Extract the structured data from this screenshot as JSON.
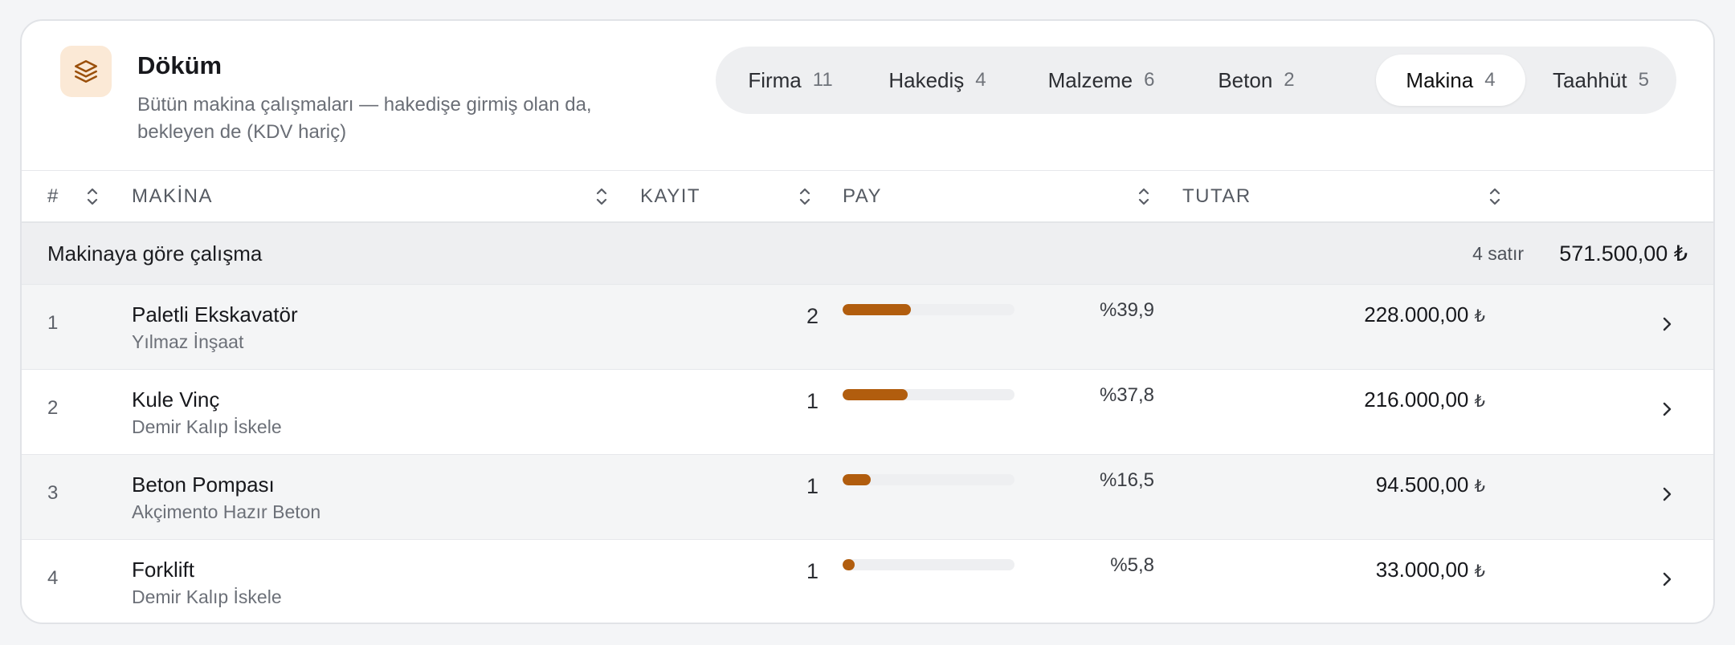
{
  "header": {
    "icon": "stack-layers-icon",
    "title": "Döküm",
    "subtitle": "Bütün makina çalışmaları — hakedişe girmiş olan da, bekleyen de (KDV hariç)"
  },
  "tabs": [
    {
      "label": "Firma",
      "count": "11",
      "active": false
    },
    {
      "label": "Hakediş",
      "count": "4",
      "active": false
    },
    {
      "label": "Malzeme",
      "count": "6",
      "active": false
    },
    {
      "label": "Beton",
      "count": "2",
      "active": false
    },
    {
      "label": "Makina",
      "count": "4",
      "active": true
    },
    {
      "label": "Taahhüt",
      "count": "5",
      "active": false
    }
  ],
  "columns": {
    "index": "#",
    "machine": "MAKİNA",
    "records": "KAYIT",
    "share": "PAY",
    "amount": "TUTAR"
  },
  "group": {
    "title": "Makinaya göre çalışma",
    "row_count": "4 satır",
    "total": "571.500,00 ₺"
  },
  "rows": [
    {
      "index": "1",
      "name": "Paletli Ekskavatör",
      "company": "Yılmaz İnşaat",
      "records": "2",
      "share_label": "%39,9",
      "share_value": 39.9,
      "amount": "228.000,00",
      "currency": "₺"
    },
    {
      "index": "2",
      "name": "Kule Vinç",
      "company": "Demir Kalıp İskele",
      "records": "1",
      "share_label": "%37,8",
      "share_value": 37.8,
      "amount": "216.000,00",
      "currency": "₺"
    },
    {
      "index": "3",
      "name": "Beton Pompası",
      "company": "Akçimento Hazır Beton",
      "records": "1",
      "share_label": "%16,5",
      "share_value": 16.5,
      "amount": "94.500,00",
      "currency": "₺"
    },
    {
      "index": "4",
      "name": "Forklift",
      "company": "Demir Kalıp İskele",
      "records": "1",
      "share_label": "%5,8",
      "share_value": 5.8,
      "amount": "33.000,00",
      "currency": "₺"
    }
  ],
  "colors": {
    "accent": "#b15d0e",
    "accent_soft": "#fbe9d6"
  }
}
